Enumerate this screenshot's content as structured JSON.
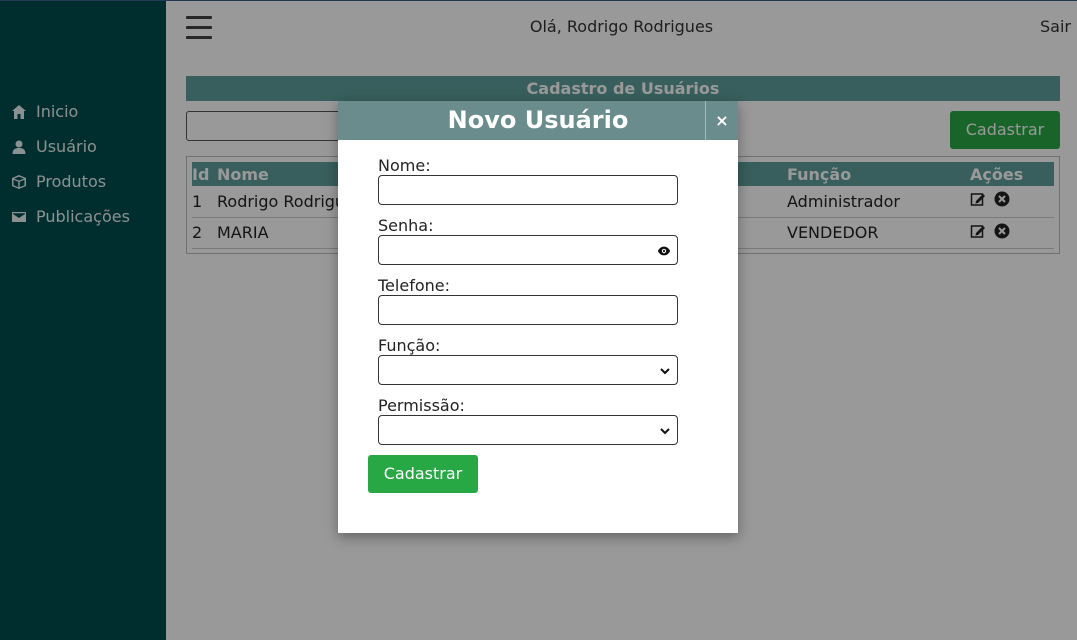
{
  "topbar": {
    "greeting": "Olá, Rodrigo Rodrigues",
    "logout": "Sair"
  },
  "sidebar": {
    "items": [
      {
        "label": "Inicio",
        "icon": "home-icon"
      },
      {
        "label": "Usuário",
        "icon": "user-icon"
      },
      {
        "label": "Produtos",
        "icon": "box-icon"
      },
      {
        "label": "Publicações",
        "icon": "envelope-icon"
      }
    ]
  },
  "main": {
    "title": "Cadastro de Usuários",
    "register_button": "Cadastrar",
    "table": {
      "headers": {
        "id": "Id",
        "nome": "Nome",
        "funcao": "Função",
        "acoes": "Ações"
      },
      "rows": [
        {
          "id": "1",
          "nome": "Rodrigo Rodrigues",
          "funcao": "Administrador"
        },
        {
          "id": "2",
          "nome": "MARIA",
          "funcao": "VENDEDOR"
        }
      ]
    }
  },
  "modal": {
    "title": "Novo Usuário",
    "close": "×",
    "labels": {
      "nome": "Nome:",
      "senha": "Senha:",
      "telefone": "Telefone:",
      "funcao": "Função:",
      "permissao": "Permissão:"
    },
    "submit": "Cadastrar"
  },
  "colors": {
    "sidebar": "#004d4d",
    "accent": "#5e9f9b",
    "modal_header": "#6a8c8c",
    "success": "#28a745"
  }
}
